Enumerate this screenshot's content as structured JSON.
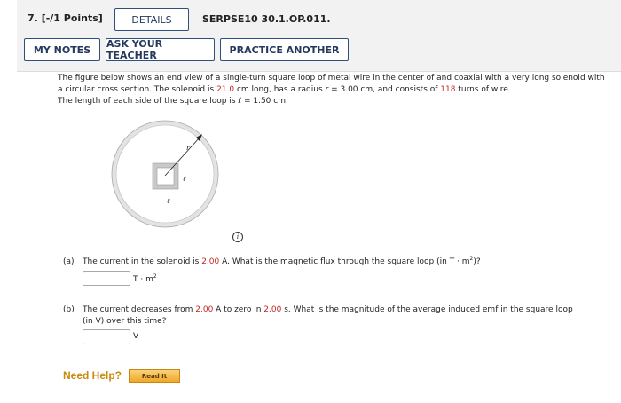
{
  "header": {
    "question_number": "7.",
    "points": "[-/1 Points]",
    "details_label": "DETAILS",
    "assignment_id": "SERPSE10 30.1.OP.011.",
    "my_notes_label": "MY NOTES",
    "ask_teacher_label": "ASK YOUR TEACHER",
    "practice_label": "PRACTICE ANOTHER"
  },
  "problem": {
    "t1": "The figure below shows an end view of a single-turn square loop of metal wire in the center of and coaxial with a very long solenoid with a circular cross section. The solenoid is ",
    "length_value": "21.0",
    "t2": " cm long, has a radius ",
    "r_var": "r",
    "t3": " = 3.00 cm, and consists of ",
    "turns_value": "118",
    "t4": " turns of wire.",
    "t5": "The length of each side of the square loop is ",
    "l_var": "ℓ",
    "t6": " = 1.50 cm."
  },
  "figure": {
    "r_label": "r",
    "l_label_side": "ℓ",
    "l_label_bottom": "ℓ"
  },
  "info_icon": "i",
  "part_a": {
    "label": "(a)",
    "q1": "The current in the solenoid is ",
    "current_value": "2.00",
    "q2": " A. What is the magnetic flux through the square loop (in T · m",
    "q2_sup": "2",
    "q3": ")?",
    "answer_value": "",
    "unit": "T · m",
    "unit_sup": "2"
  },
  "part_b": {
    "label": "(b)",
    "q1": "The current decreases from ",
    "current_value": "2.00",
    "q2": " A to zero in ",
    "time_value": "2.00",
    "q3": " s. What is the magnitude of the average induced emf in the square loop",
    "q4": "(in V) over this time?",
    "answer_value": "",
    "unit": "V"
  },
  "help": {
    "need_help": "Need Help?",
    "read_it": "Read It"
  },
  "colors": {
    "highlight_red": "#c0282a",
    "button_border": "#2f4f7f",
    "help_orange": "#c98a0d"
  }
}
